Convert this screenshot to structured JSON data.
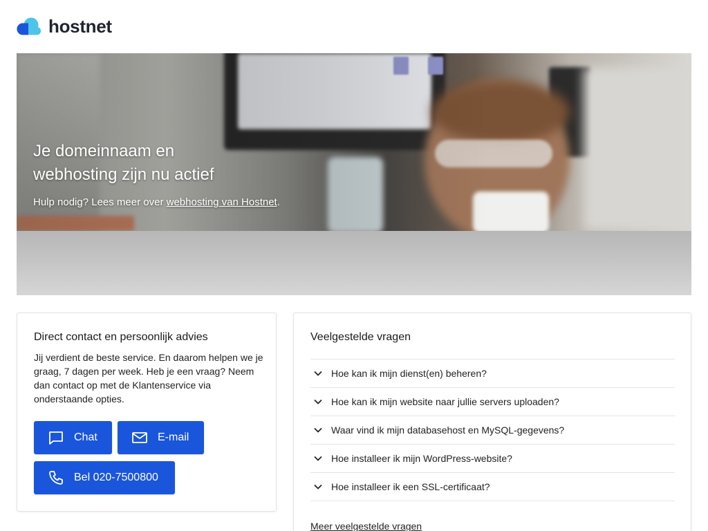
{
  "brand": {
    "name": "hostnet",
    "colors": {
      "primary": "#1a56db",
      "logo_dark": "#1f2430",
      "logo_light": "#4fc3e8"
    }
  },
  "hero": {
    "title": "Je domeinnaam en webhosting zijn nu actief",
    "subtitle_prefix": "Hulp nodig? Lees meer over ",
    "subtitle_link": "webhosting van Hostnet",
    "subtitle_suffix": "."
  },
  "contact": {
    "title": "Direct contact en persoonlijk advies",
    "body": "Jij verdient de beste service. En daarom helpen we je graag, 7 dagen per week. Heb je een vraag? Neem dan contact op met de Klantenservice via onderstaande opties.",
    "buttons": {
      "chat": {
        "label": "Chat",
        "icon": "chat-bubble-icon"
      },
      "email": {
        "label": "E-mail",
        "icon": "envelope-icon"
      },
      "call": {
        "label": "Bel 020-7500800",
        "icon": "phone-icon"
      }
    }
  },
  "faq": {
    "title": "Veelgestelde vragen",
    "items": [
      "Hoe kan ik mijn dienst(en) beheren?",
      "Hoe kan ik mijn website naar jullie servers uploaden?",
      "Waar vind ik mijn databasehost en MySQL-gegevens?",
      "Hoe installeer ik mijn WordPress-website?",
      "Hoe installeer ik een SSL-certificaat?"
    ],
    "more_link": "Meer veelgestelde vragen"
  }
}
